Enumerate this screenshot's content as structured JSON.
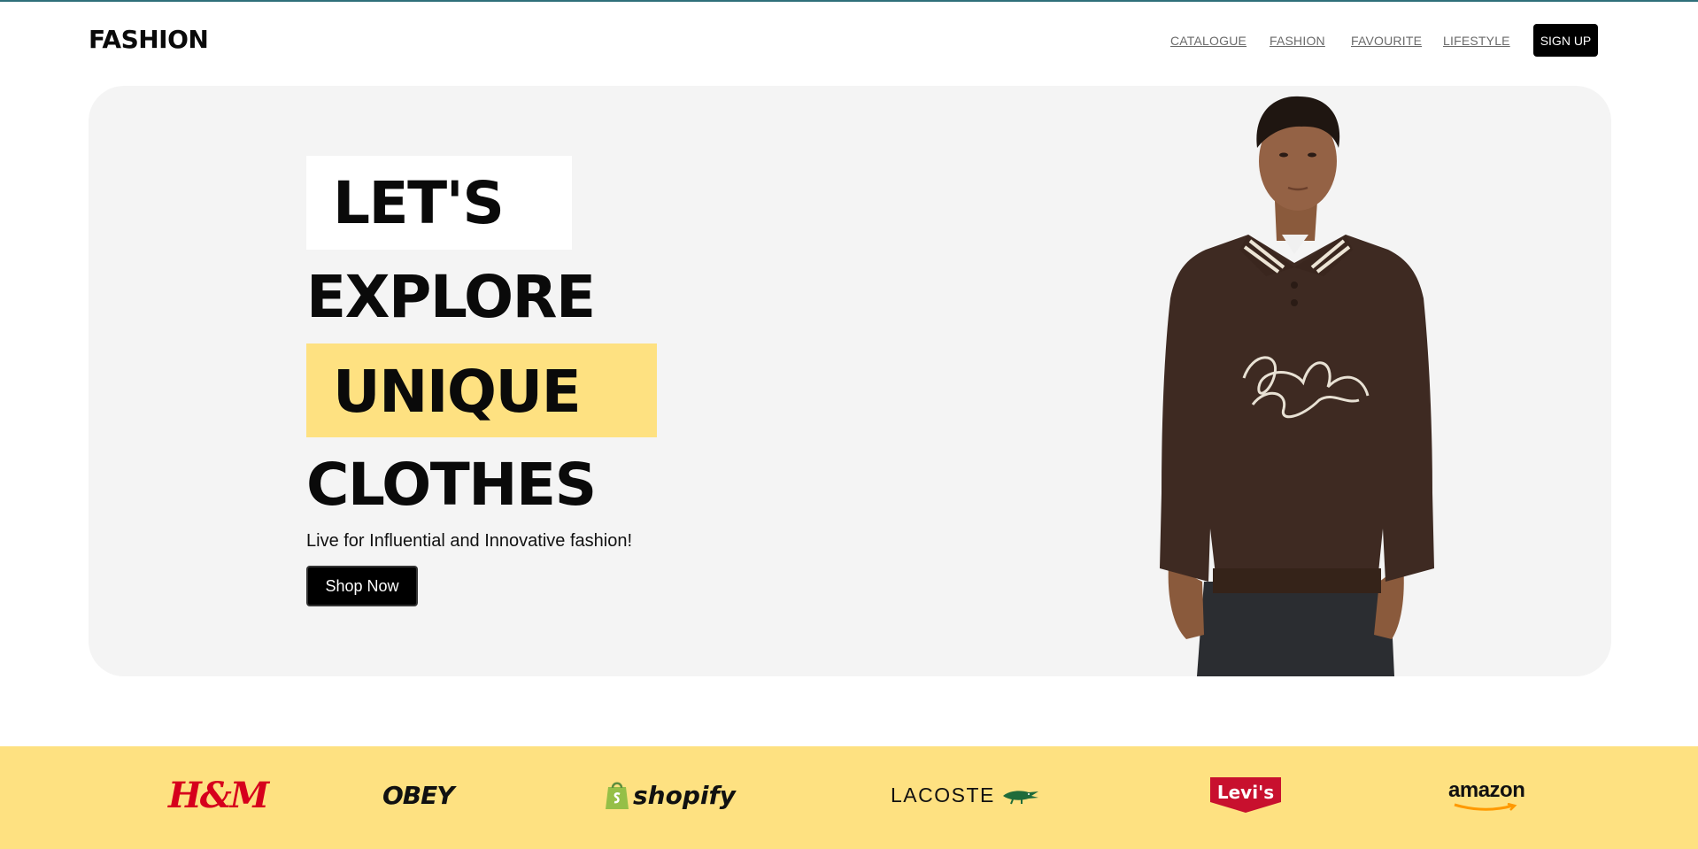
{
  "header": {
    "logo": "FASHION",
    "nav": [
      "CATALOGUE",
      "FASHION",
      "FAVOURITE",
      "LIFESTYLE"
    ],
    "signup_label": "SIGN UP"
  },
  "hero": {
    "headline_words": [
      "LET'S",
      "EXPLORE",
      "UNIQUE",
      "CLOTHES"
    ],
    "tagline": "Live for Influential and Innovative fashion!",
    "cta_label": "Shop Now",
    "highlight_color": "#fee181",
    "image_alt": "Model in brown polo sweatshirt"
  },
  "brands": {
    "items": [
      {
        "name": "H&M",
        "display": "H&M"
      },
      {
        "name": "OBEY",
        "display": "OBEY"
      },
      {
        "name": "shopify",
        "display": "shopify"
      },
      {
        "name": "LACOSTE",
        "display": "LACOSTE"
      },
      {
        "name": "Levi's",
        "display": "Levi's"
      },
      {
        "name": "amazon",
        "display": "amazon"
      }
    ],
    "background": "#fee181"
  }
}
